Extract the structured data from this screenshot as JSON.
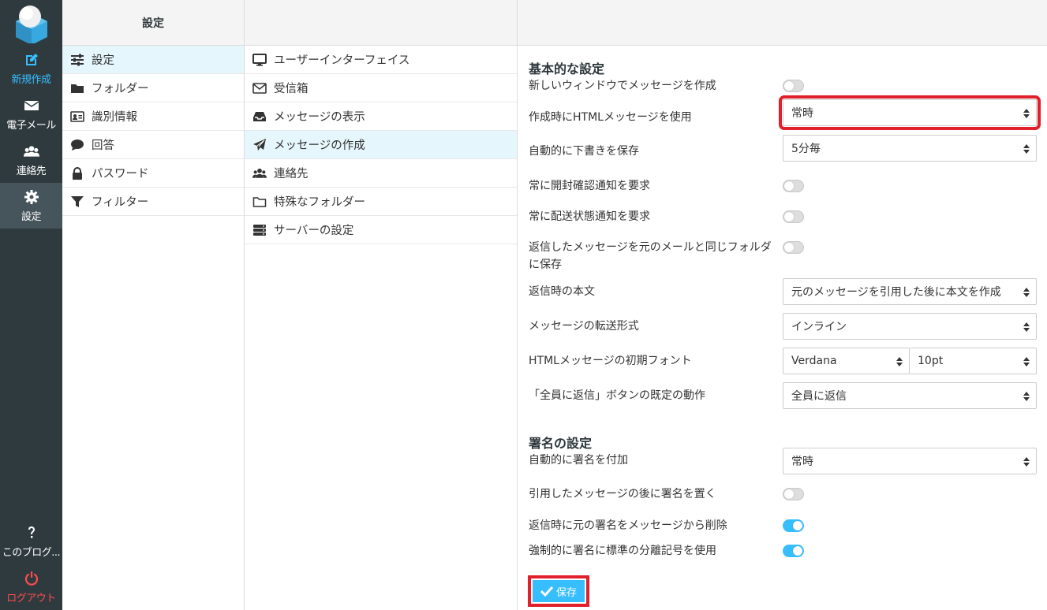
{
  "nav": {
    "compose": "新規作成",
    "mail": "電子メール",
    "contacts": "連絡先",
    "settings": "設定",
    "about": "このブログ...",
    "logout": "ログアウト"
  },
  "col1": {
    "header": "設定",
    "items": [
      {
        "label": "設定",
        "icon": "sliders-icon"
      },
      {
        "label": "フォルダー",
        "icon": "folder-icon"
      },
      {
        "label": "識別情報",
        "icon": "id-card-icon"
      },
      {
        "label": "回答",
        "icon": "comment-icon"
      },
      {
        "label": "パスワード",
        "icon": "lock-icon"
      },
      {
        "label": "フィルター",
        "icon": "filter-icon"
      }
    ]
  },
  "col2": {
    "items": [
      {
        "label": "ユーザーインターフェイス",
        "icon": "monitor-icon"
      },
      {
        "label": "受信箱",
        "icon": "envelope-icon"
      },
      {
        "label": "メッセージの表示",
        "icon": "inbox-icon"
      },
      {
        "label": "メッセージの作成",
        "icon": "paper-plane-icon"
      },
      {
        "label": "連絡先",
        "icon": "users-icon"
      },
      {
        "label": "特殊なフォルダー",
        "icon": "folder-outline-icon"
      },
      {
        "label": "サーバーの設定",
        "icon": "server-icon"
      }
    ]
  },
  "main": {
    "section1_title": "基本的な設定",
    "s1": {
      "new_window": {
        "label": "新しいウィンドウでメッセージを作成",
        "on": false
      },
      "html_compose": {
        "label": "作成時にHTMLメッセージを使用",
        "value": "常時"
      },
      "draft_autosave": {
        "label": "自動的に下書きを保存",
        "value": "5分毎"
      },
      "mdn": {
        "label": "常に開封確認通知を要求",
        "on": false
      },
      "dsn": {
        "label": "常に配送状態通知を要求",
        "on": false
      },
      "reply_same_folder": {
        "label": "返信したメッセージを元のメールと同じフォルダに保存",
        "on": false
      },
      "reply_mode": {
        "label": "返信時の本文",
        "value": "元のメッセージを引用した後に本文を作成"
      },
      "forward_type": {
        "label": "メッセージの転送形式",
        "value": "インライン"
      },
      "default_font": {
        "label": "HTMLメッセージの初期フォント",
        "font": "Verdana",
        "size": "10pt"
      },
      "reply_all": {
        "label": "「全員に返信」ボタンの既定の動作",
        "value": "全員に返信"
      }
    },
    "section2_title": "署名の設定",
    "s2": {
      "auto_sig": {
        "label": "自動的に署名を付加",
        "value": "常時"
      },
      "sig_below": {
        "label": "引用したメッセージの後に署名を置く",
        "on": false
      },
      "strip_sig": {
        "label": "返信時に元の署名をメッセージから削除",
        "on": true
      },
      "force_sep": {
        "label": "強制的に署名に標準の分離記号を使用",
        "on": true
      }
    },
    "save_label": "保存"
  },
  "colors": {
    "nav_bg": "#2f3a3f",
    "accent": "#37beff",
    "highlight": "#e0202a",
    "logout": "#ff4c4c"
  }
}
